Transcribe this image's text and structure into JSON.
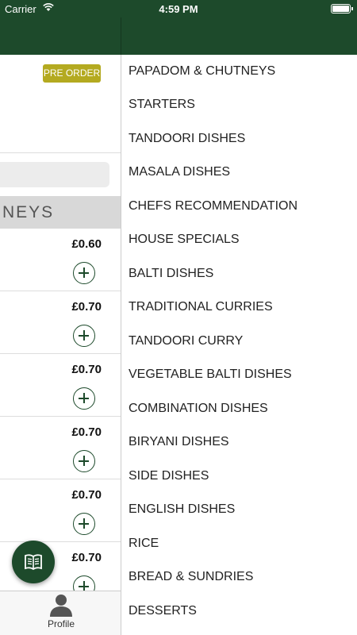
{
  "status_bar": {
    "carrier": "Carrier",
    "time": "4:59 PM"
  },
  "colors": {
    "brand": "#1d4a2b",
    "pre_order": "#b4aa20",
    "category_bg": "#d8d8d8"
  },
  "main": {
    "pre_order_label": "PRE ORDER",
    "category_header": "NEYS",
    "items": [
      {
        "price": "£0.60"
      },
      {
        "price": "£0.70"
      },
      {
        "price": "£0.70"
      },
      {
        "price": "£0.70"
      },
      {
        "price": "£0.70"
      },
      {
        "price": "£0.70"
      }
    ]
  },
  "fab": {
    "icon": "book-icon"
  },
  "tab_bar": {
    "profile_label": "Profile",
    "profile_icon": "person-icon"
  },
  "side_menu": {
    "items": [
      "PAPADOM & CHUTNEYS",
      "STARTERS",
      "TANDOORI DISHES",
      "MASALA DISHES",
      "CHEFS RECOMMENDATION",
      "HOUSE SPECIALS",
      "BALTI DISHES",
      "TRADITIONAL CURRIES",
      "TANDOORI CURRY",
      "VEGETABLE BALTI DISHES",
      "COMBINATION DISHES",
      "BIRYANI DISHES",
      "SIDE DISHES",
      "ENGLISH DISHES",
      "RICE",
      "BREAD & SUNDRIES",
      "DESSERTS"
    ]
  }
}
